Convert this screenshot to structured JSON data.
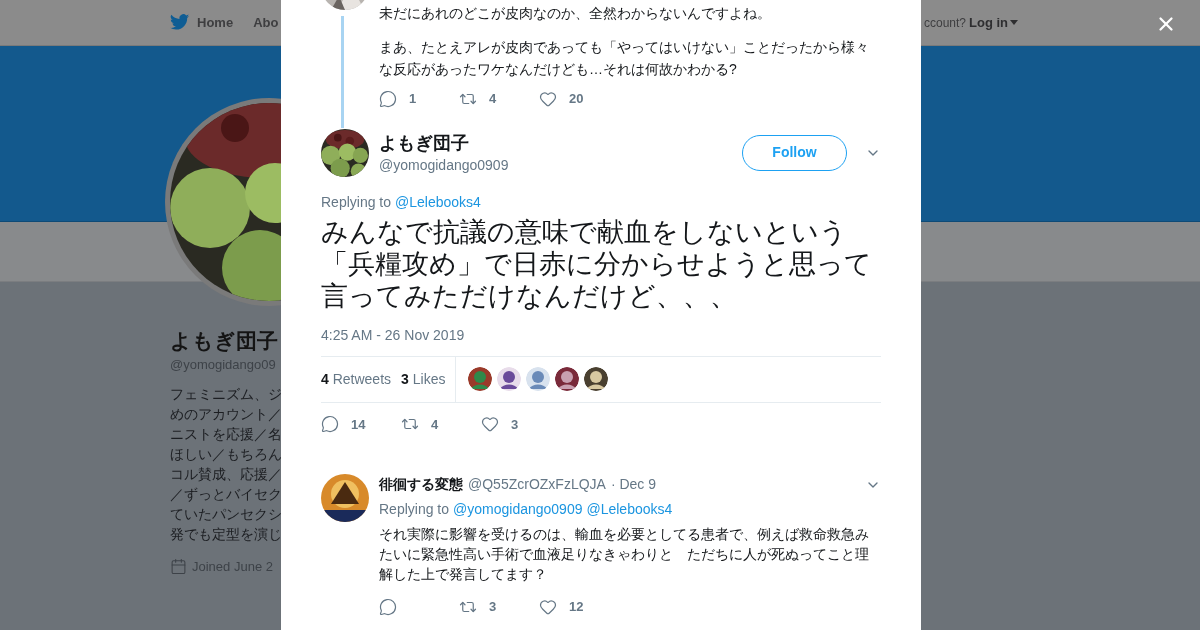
{
  "nav": {
    "items": [
      {
        "label": "Home"
      },
      {
        "label": "Abo"
      }
    ],
    "account_prompt": "ccount?",
    "login": "Log in"
  },
  "profile": {
    "name": "よもぎ団子",
    "handle": "@yomogidango09",
    "bio_lines": [
      "フェミニズム、ジ",
      "めのアカウント／",
      "ニストを応援／名",
      "ほしい／もちろん",
      "コル賛成、応援／",
      "／ずっとバイセク",
      "ていたパンセクシ",
      "発でも定型を演じ"
    ],
    "joined": "Joined June 2"
  },
  "modal": {
    "parent_tweet": {
      "paragraphs": [
        "未だにあれのどこが皮肉なのか、全然わからないんですよね。",
        "まあ、たとえアレが皮肉であっても「やってはいけない」ことだったから様々な反応があったワケなんだけども…それは何故かわかる?"
      ],
      "actions": [
        {
          "kind": "reply",
          "count": "1"
        },
        {
          "kind": "retweet",
          "count": "4"
        },
        {
          "kind": "like",
          "count": "20"
        }
      ]
    },
    "tweet": {
      "name": "よもぎ団子",
      "handle": "@yomogidango0909",
      "follow": "Follow",
      "replying_label": "Replying to",
      "replying_to": [
        "@Lelebooks4"
      ],
      "text": "みんなで抗議の意味で献血をしないという「兵糧攻め」で日赤に分からせようと思って言ってみただけなんだけど、、、",
      "time": "4:25 AM - 26 Nov 2019",
      "stats": [
        {
          "count": "4",
          "label": "Retweets"
        },
        {
          "count": "3",
          "label": "Likes"
        }
      ],
      "likers": [
        {
          "kind": "picture"
        },
        {
          "kind": "picture"
        },
        {
          "kind": "picture"
        },
        {
          "kind": "picture"
        },
        {
          "kind": "picture"
        }
      ],
      "actions": [
        {
          "kind": "reply",
          "count": "14"
        },
        {
          "kind": "retweet",
          "count": "4"
        },
        {
          "kind": "like",
          "count": "3"
        }
      ]
    },
    "replies": [
      {
        "name": "徘徊する変態",
        "handle": "@Q55ZcrOZxFzLQJA",
        "date": "· Dec 9",
        "replying_label": "Replying to",
        "replying_to": [
          "@yomogidango0909",
          "@Lelebooks4"
        ],
        "text": "それ実際に影響を受けるのは、輸血を必要としてる患者で、例えば救命救急みたいに緊急性高い手術で血液足りなきゃわりと　ただちに人が死ぬってこと理解した上で発言してます？",
        "actions": [
          {
            "kind": "reply"
          },
          {
            "kind": "retweet",
            "count": "3"
          },
          {
            "kind": "like",
            "count": "12"
          }
        ]
      }
    ]
  }
}
